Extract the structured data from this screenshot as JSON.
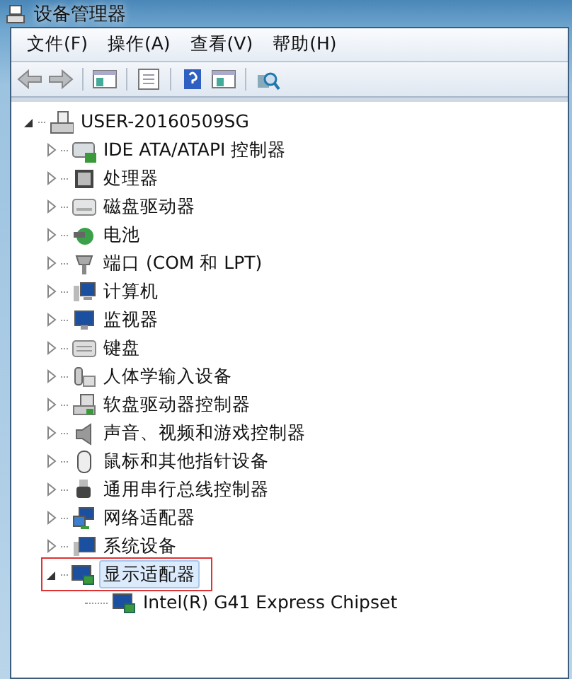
{
  "window": {
    "title": "设备管理器"
  },
  "menu": [
    {
      "label": "文件(F)"
    },
    {
      "label": "操作(A)"
    },
    {
      "label": "查看(V)"
    },
    {
      "label": "帮助(H)"
    }
  ],
  "tree": {
    "label": "USER-20160509SG",
    "expanded": true,
    "selected": false,
    "children": [
      {
        "label": "IDE ATA/ATAPI 控制器",
        "expanded": false,
        "selected": false
      },
      {
        "label": "处理器",
        "expanded": false,
        "selected": false
      },
      {
        "label": "磁盘驱动器",
        "expanded": false,
        "selected": false
      },
      {
        "label": "电池",
        "expanded": false,
        "selected": false
      },
      {
        "label": "端口 (COM 和 LPT)",
        "expanded": false,
        "selected": false
      },
      {
        "label": "计算机",
        "expanded": false,
        "selected": false
      },
      {
        "label": "监视器",
        "expanded": false,
        "selected": false
      },
      {
        "label": "键盘",
        "expanded": false,
        "selected": false
      },
      {
        "label": "人体学输入设备",
        "expanded": false,
        "selected": false
      },
      {
        "label": "软盘驱动器控制器",
        "expanded": false,
        "selected": false
      },
      {
        "label": "声音、视频和游戏控制器",
        "expanded": false,
        "selected": false
      },
      {
        "label": "鼠标和其他指针设备",
        "expanded": false,
        "selected": false
      },
      {
        "label": "通用串行总线控制器",
        "expanded": false,
        "selected": false
      },
      {
        "label": "网络适配器",
        "expanded": false,
        "selected": false
      },
      {
        "label": "系统设备",
        "expanded": false,
        "selected": false
      },
      {
        "label": "显示适配器",
        "expanded": true,
        "selected": true,
        "children": [
          {
            "label": "Intel(R) G41 Express Chipset",
            "selected": false
          }
        ]
      }
    ]
  }
}
